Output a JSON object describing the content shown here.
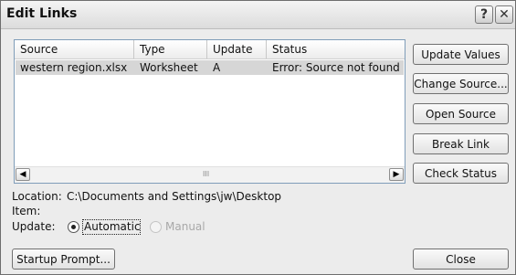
{
  "window": {
    "title": "Edit Links",
    "help_glyph": "?",
    "close_glyph": "✕"
  },
  "table": {
    "columns": [
      "Source",
      "Type",
      "Update",
      "Status"
    ],
    "rows": [
      {
        "source": "western region.xlsx",
        "type": "Worksheet",
        "update": "A",
        "status": "Error: Source not found"
      }
    ]
  },
  "scrollbar": {
    "left_glyph": "◀",
    "right_glyph": "▶",
    "grip": "III"
  },
  "buttons": {
    "update_values": "Update Values",
    "change_source": "Change Source...",
    "open_source": "Open Source",
    "break_link": "Break Link",
    "check_status": "Check Status",
    "startup_prompt": "Startup Prompt...",
    "close": "Close"
  },
  "details": {
    "location_label": "Location:",
    "location_value": "C:\\Documents and Settings\\jw\\Desktop",
    "item_label": "Item:",
    "update_label": "Update:",
    "automatic_label": "Automatic",
    "manual_label": "Manual",
    "selected_update": "Automatic"
  }
}
